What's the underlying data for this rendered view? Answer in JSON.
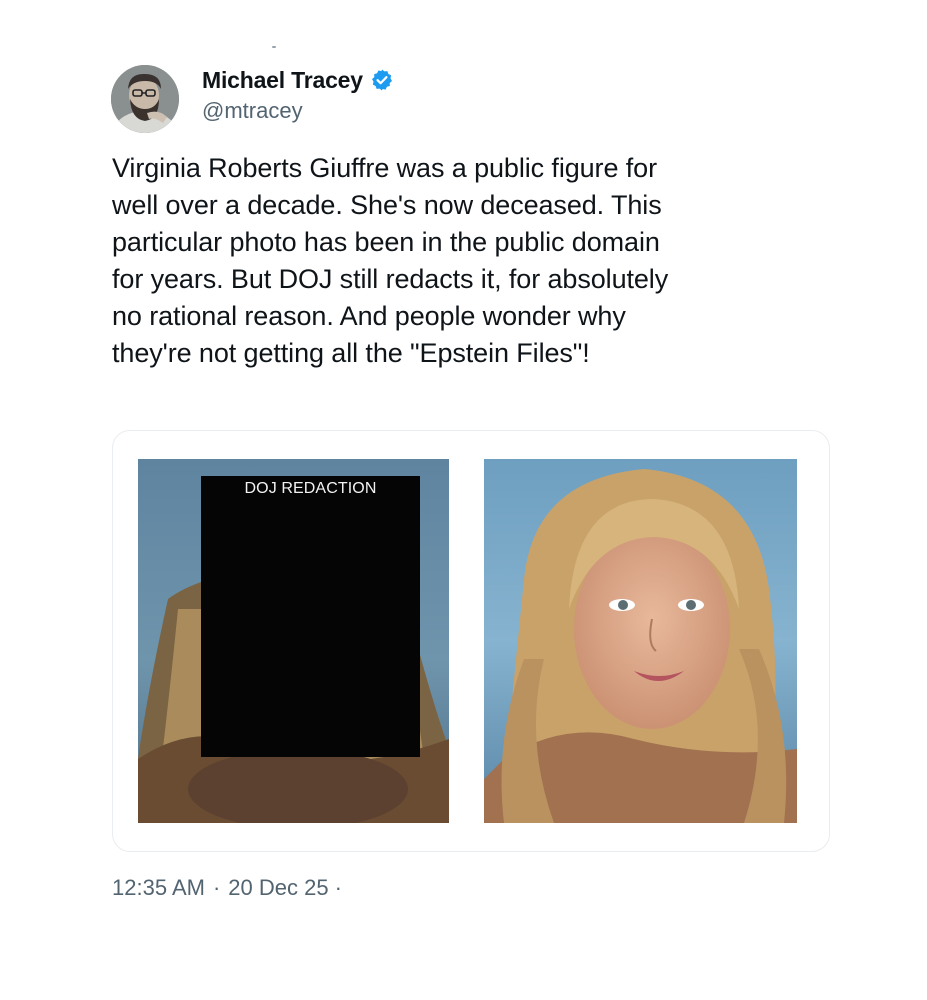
{
  "author": {
    "display_name": "Michael Tracey",
    "handle": "@mtracey",
    "verified": true,
    "avatar_icon": "bearded-man-avatar-icon",
    "verified_icon": "verified-badge-icon",
    "verified_color": "#1d9bf0"
  },
  "tweet": {
    "lines": [
      "Virginia Roberts Giuffre was a public figure for",
      "well over a decade. She's now deceased. This",
      "particular photo has been in the public domain",
      "for years. But DOJ still redacts it, for absolutely",
      "no rational reason. And people wonder why",
      "they're not getting all the \"Epstein Files\"!"
    ]
  },
  "media": {
    "left_photo": {
      "redaction_label": "DOJ REDACTION"
    },
    "right_photo": {}
  },
  "footer": {
    "time": "12:35 AM",
    "separator": "·",
    "date": "20 Dec 25",
    "trailing": "·"
  }
}
